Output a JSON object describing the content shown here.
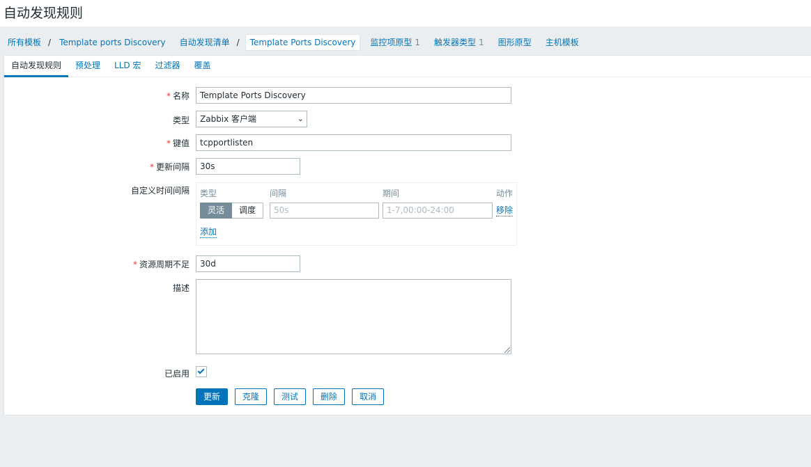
{
  "page_title": "自动发现规则",
  "breadcrumbs": {
    "all_templates": "所有模板",
    "template": "Template ports Discovery",
    "discovery_list": "自动发现清单",
    "current_rule": "Template Ports Discovery",
    "item_prototypes": "监控项原型",
    "item_prototypes_count": "1",
    "trigger_types": "触发器类型",
    "trigger_types_count": "1",
    "graph_prototypes": "图形原型",
    "host_templates": "主机模板"
  },
  "tabs": [
    "自动发现规则",
    "预处理",
    "LLD 宏",
    "过滤器",
    "覆盖"
  ],
  "form": {
    "name": {
      "label": "名称",
      "value": "Template Ports Discovery"
    },
    "type": {
      "label": "类型",
      "value": "Zabbix 客户端"
    },
    "key": {
      "label": "键值",
      "value": "tcpportlisten"
    },
    "update_interval": {
      "label": "更新间隔",
      "value": "30s"
    },
    "custom_intervals": {
      "label": "自定义时间间隔",
      "headers": {
        "type": "类型",
        "interval": "间隔",
        "period": "期间",
        "action": "动作"
      },
      "mode_flexible": "灵活",
      "mode_scheduling": "调度",
      "interval_placeholder": "50s",
      "period_placeholder": "1-7,00:00-24:00",
      "remove_link": "移除",
      "add_link": "添加"
    },
    "lifetime": {
      "label": "资源周期不足",
      "value": "30d"
    },
    "description": {
      "label": "描述",
      "value": ""
    },
    "enabled": {
      "label": "已启用",
      "checked": true
    }
  },
  "buttons": {
    "update": "更新",
    "clone": "克隆",
    "test": "测试",
    "delete": "删除",
    "cancel": "取消"
  },
  "colors": {
    "accent": "#0275b8",
    "required": "#e33734",
    "muted": "#768d99"
  }
}
